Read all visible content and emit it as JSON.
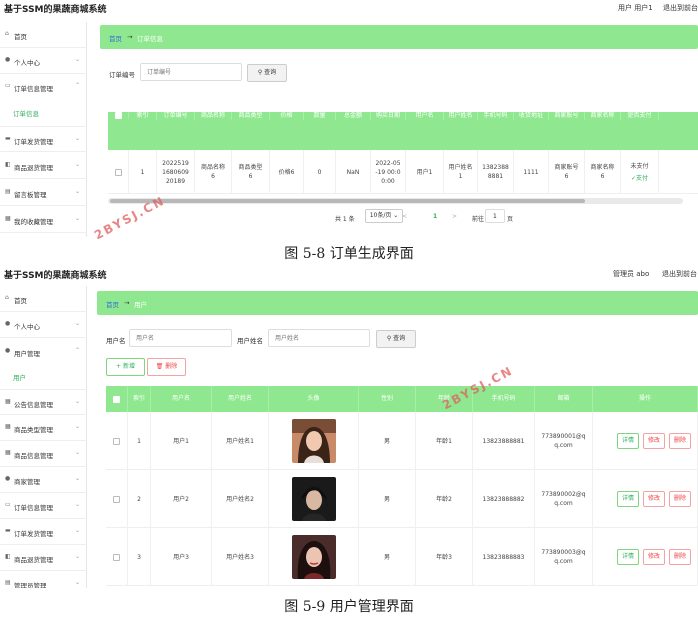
{
  "panel1": {
    "app_title": "基于SSM的果蔬商城系统",
    "user_label": "用户 用户1",
    "logout": "退出到前台",
    "sidebar": [
      {
        "label": "首页",
        "icon": "home-icon"
      },
      {
        "label": "个人中心",
        "icon": "user-icon"
      },
      {
        "label": "订单信息管理",
        "icon": "order-icon",
        "expanded": true
      },
      {
        "label": "订单发货管理",
        "icon": "truck-icon"
      },
      {
        "label": "商品退货管理",
        "icon": "return-icon"
      },
      {
        "label": "留言板管理",
        "icon": "message-icon"
      },
      {
        "label": "我的收藏管理",
        "icon": "star-icon"
      }
    ],
    "sidebar_sub": "订单信息",
    "breadcrumb": {
      "home": "首页",
      "arrow": "→",
      "current": "订单信息"
    },
    "search": {
      "label": "订单编号",
      "placeholder": "订单编号",
      "button": "查询"
    },
    "table": {
      "headers": [
        "",
        "索引",
        "订单编号",
        "商品名称",
        "商品类型",
        "价格",
        "数量",
        "总金额",
        "购买日期",
        "用户名",
        "用户姓名",
        "手机号码",
        "收货地址",
        "商家账号",
        "商家名称",
        "是否支付"
      ],
      "row": [
        "",
        "1",
        "2022519\n1680609\n20189",
        "商品名称\n6",
        "商品类型\n6",
        "价格6",
        "0",
        "NaN",
        "2022-05\n-19 00:0\n0:00",
        "用户1",
        "用户姓名\n1",
        "1382388\n8881",
        "1111",
        "商家账号\n6",
        "商家名称\n6",
        "未支付"
      ],
      "pay_link": "支付"
    },
    "pagination": {
      "total": "共 1 条",
      "page_size": "10条/页",
      "prev": "<",
      "current": "1",
      "next": ">",
      "goto": "前往",
      "page_input": "1",
      "page_unit": "页"
    }
  },
  "caption1": "图 5-8 订单生成界面",
  "panel2": {
    "app_title": "基于SSM的果蔬商城系统",
    "user_label": "管理员 abo",
    "logout": "退出到前台",
    "sidebar": [
      {
        "label": "首页",
        "icon": "home-icon"
      },
      {
        "label": "个人中心",
        "icon": "user-icon"
      },
      {
        "label": "用户管理",
        "icon": "users-icon",
        "expanded": true
      },
      {
        "label": "公告信息管理",
        "icon": "notice-icon"
      },
      {
        "label": "商品类型管理",
        "icon": "category-icon"
      },
      {
        "label": "商品信息管理",
        "icon": "goods-icon"
      },
      {
        "label": "商家管理",
        "icon": "shop-icon"
      },
      {
        "label": "订单信息管理",
        "icon": "order-icon"
      },
      {
        "label": "订单发货管理",
        "icon": "truck-icon"
      },
      {
        "label": "商品退货管理",
        "icon": "return-icon"
      },
      {
        "label": "管理员管理",
        "icon": "admin-icon"
      }
    ],
    "sidebar_sub": "用户",
    "breadcrumb": {
      "home": "首页",
      "arrow": "→",
      "current": "用户"
    },
    "search": {
      "label1": "用户名",
      "placeholder1": "用户名",
      "label2": "用户姓名",
      "placeholder2": "用户姓名",
      "button": "查询"
    },
    "actions": {
      "add": "+ 新增",
      "delete": "删除"
    },
    "table": {
      "headers": [
        "",
        "索引",
        "用户名",
        "用户姓名",
        "头像",
        "性别",
        "年龄",
        "手机号码",
        "邮箱",
        "操作"
      ],
      "rows": [
        {
          "idx": "1",
          "username": "用户1",
          "name": "用户姓名1",
          "gender": "男",
          "age": "年龄1",
          "phone": "13823888881",
          "email": "773890001@q\nq.com"
        },
        {
          "idx": "2",
          "username": "用户2",
          "name": "用户姓名2",
          "gender": "男",
          "age": "年龄2",
          "phone": "13823888882",
          "email": "773890002@q\nq.com"
        },
        {
          "idx": "3",
          "username": "用户3",
          "name": "用户姓名3",
          "gender": "男",
          "age": "年龄3",
          "phone": "13823888883",
          "email": "773890003@q\nq.com"
        }
      ],
      "ops": {
        "detail": "详情",
        "edit": "修改",
        "delete": "删除"
      }
    }
  },
  "caption2": "图 5-9 用户管理界面",
  "watermark": "2BYSJ.CN",
  "colors": {
    "accent_green": "#8fe88f",
    "link_green": "#2db05d",
    "danger": "#e44444"
  }
}
